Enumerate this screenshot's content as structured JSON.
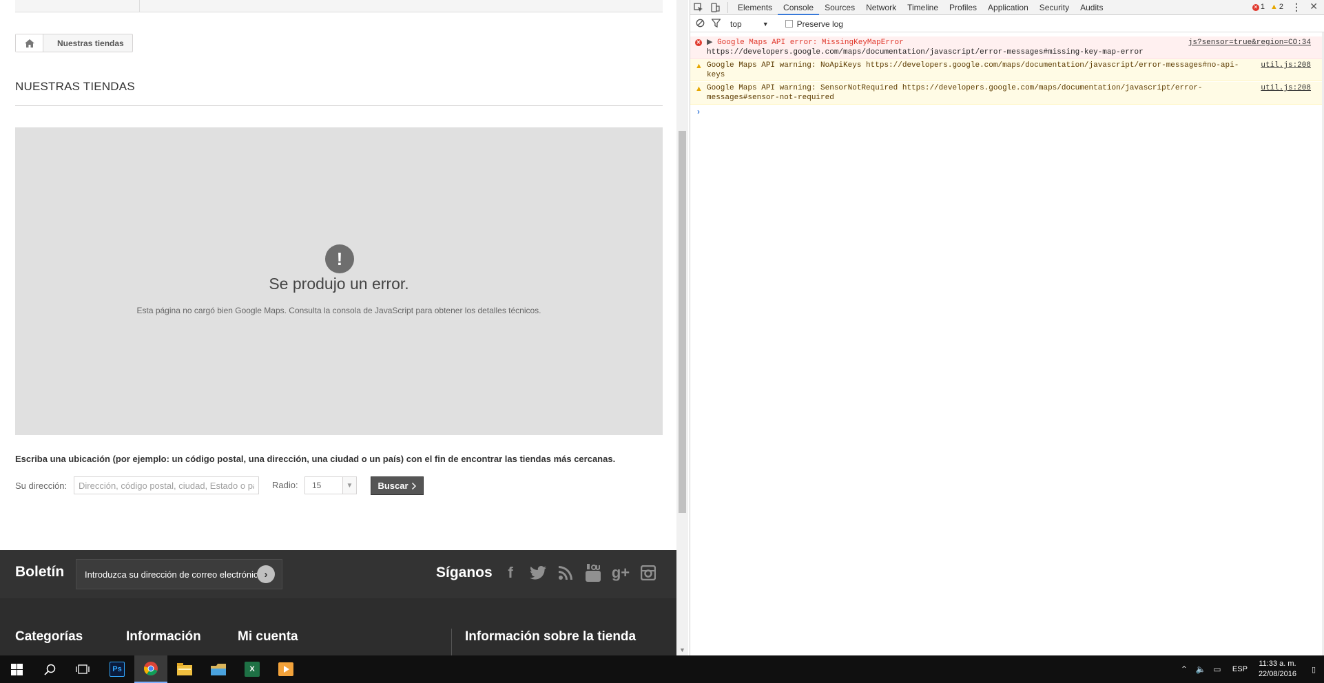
{
  "breadcrumb": {
    "current": "Nuestras tiendas"
  },
  "page_title": "NUESTRAS TIENDAS",
  "map_error": {
    "title": "Se produjo un error.",
    "description": "Esta página no cargó bien Google Maps. Consulta la consola de JavaScript para obtener los detalles técnicos."
  },
  "store_search": {
    "instructions": "Escriba una ubicación (por ejemplo: un código postal, una dirección, una ciudad o un país) con el fin de encontrar las tiendas más cercanas.",
    "address_label": "Su dirección:",
    "address_placeholder": "Dirección, código postal, ciudad, Estado o país",
    "radius_label": "Radio:",
    "radius_value": "15",
    "search_label": "Buscar"
  },
  "footer": {
    "newsletter_label": "Boletín",
    "newsletter_placeholder": "Introduzca su dirección de correo electrónico",
    "follow_label": "Síganos",
    "social_icons": [
      "facebook-icon",
      "twitter-icon",
      "rss-icon",
      "youtube-icon",
      "google-plus-icon",
      "instagram-icon"
    ],
    "columns": [
      "Categorías",
      "Información",
      "Mi cuenta",
      "Información sobre la tienda"
    ]
  },
  "devtools": {
    "tabs": [
      "Elements",
      "Console",
      "Sources",
      "Network",
      "Timeline",
      "Profiles",
      "Application",
      "Security",
      "Audits"
    ],
    "active_tab": "Console",
    "error_count": "1",
    "warning_count": "2",
    "context": "top",
    "preserve_log_label": "Preserve log",
    "messages": [
      {
        "level": "error",
        "text": "Google Maps API error: MissingKeyMapError",
        "url": "https://developers.google.com/maps/documentation/javascript/error-messages#missing-key-map-error",
        "source": "js?sensor=true&region=CO:34"
      },
      {
        "level": "warning",
        "text": "Google Maps API warning: NoApiKeys https://developers.google.com/maps/documentation/javascript/error-messages#no-api-keys",
        "source": "util.js:208"
      },
      {
        "level": "warning",
        "text": "Google Maps API warning: SensorNotRequired https://developers.google.com/maps/documentation/javascript/error-messages#sensor-not-required",
        "source": "util.js:208"
      }
    ],
    "colors": {
      "error": "#e0372b",
      "warning": "#e6a700",
      "accent": "#3879d9"
    }
  },
  "taskbar": {
    "apps": [
      "windows-start-icon",
      "search-icon",
      "task-view-icon",
      "photoshop-icon",
      "chrome-icon",
      "file-explorer-icon",
      "folder-icon",
      "excel-icon",
      "media-player-icon"
    ],
    "photoshop_label": "Ps",
    "excel_label": "X",
    "language": "ESP",
    "time": "11:33 a. m.",
    "date": "22/08/2016"
  }
}
